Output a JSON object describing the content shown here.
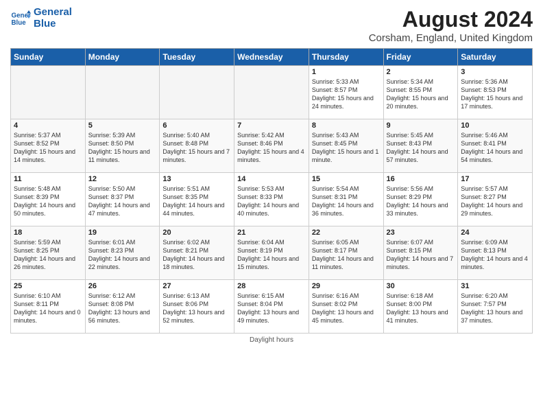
{
  "logo": {
    "line1": "General",
    "line2": "Blue"
  },
  "title": "August 2024",
  "subtitle": "Corsham, England, United Kingdom",
  "days_header": [
    "Sunday",
    "Monday",
    "Tuesday",
    "Wednesday",
    "Thursday",
    "Friday",
    "Saturday"
  ],
  "footer": "Daylight hours",
  "weeks": [
    [
      {
        "num": "",
        "info": ""
      },
      {
        "num": "",
        "info": ""
      },
      {
        "num": "",
        "info": ""
      },
      {
        "num": "",
        "info": ""
      },
      {
        "num": "1",
        "info": "Sunrise: 5:33 AM\nSunset: 8:57 PM\nDaylight: 15 hours\nand 24 minutes."
      },
      {
        "num": "2",
        "info": "Sunrise: 5:34 AM\nSunset: 8:55 PM\nDaylight: 15 hours\nand 20 minutes."
      },
      {
        "num": "3",
        "info": "Sunrise: 5:36 AM\nSunset: 8:53 PM\nDaylight: 15 hours\nand 17 minutes."
      }
    ],
    [
      {
        "num": "4",
        "info": "Sunrise: 5:37 AM\nSunset: 8:52 PM\nDaylight: 15 hours\nand 14 minutes."
      },
      {
        "num": "5",
        "info": "Sunrise: 5:39 AM\nSunset: 8:50 PM\nDaylight: 15 hours\nand 11 minutes."
      },
      {
        "num": "6",
        "info": "Sunrise: 5:40 AM\nSunset: 8:48 PM\nDaylight: 15 hours\nand 7 minutes."
      },
      {
        "num": "7",
        "info": "Sunrise: 5:42 AM\nSunset: 8:46 PM\nDaylight: 15 hours\nand 4 minutes."
      },
      {
        "num": "8",
        "info": "Sunrise: 5:43 AM\nSunset: 8:45 PM\nDaylight: 15 hours\nand 1 minute."
      },
      {
        "num": "9",
        "info": "Sunrise: 5:45 AM\nSunset: 8:43 PM\nDaylight: 14 hours\nand 57 minutes."
      },
      {
        "num": "10",
        "info": "Sunrise: 5:46 AM\nSunset: 8:41 PM\nDaylight: 14 hours\nand 54 minutes."
      }
    ],
    [
      {
        "num": "11",
        "info": "Sunrise: 5:48 AM\nSunset: 8:39 PM\nDaylight: 14 hours\nand 50 minutes."
      },
      {
        "num": "12",
        "info": "Sunrise: 5:50 AM\nSunset: 8:37 PM\nDaylight: 14 hours\nand 47 minutes."
      },
      {
        "num": "13",
        "info": "Sunrise: 5:51 AM\nSunset: 8:35 PM\nDaylight: 14 hours\nand 44 minutes."
      },
      {
        "num": "14",
        "info": "Sunrise: 5:53 AM\nSunset: 8:33 PM\nDaylight: 14 hours\nand 40 minutes."
      },
      {
        "num": "15",
        "info": "Sunrise: 5:54 AM\nSunset: 8:31 PM\nDaylight: 14 hours\nand 36 minutes."
      },
      {
        "num": "16",
        "info": "Sunrise: 5:56 AM\nSunset: 8:29 PM\nDaylight: 14 hours\nand 33 minutes."
      },
      {
        "num": "17",
        "info": "Sunrise: 5:57 AM\nSunset: 8:27 PM\nDaylight: 14 hours\nand 29 minutes."
      }
    ],
    [
      {
        "num": "18",
        "info": "Sunrise: 5:59 AM\nSunset: 8:25 PM\nDaylight: 14 hours\nand 26 minutes."
      },
      {
        "num": "19",
        "info": "Sunrise: 6:01 AM\nSunset: 8:23 PM\nDaylight: 14 hours\nand 22 minutes."
      },
      {
        "num": "20",
        "info": "Sunrise: 6:02 AM\nSunset: 8:21 PM\nDaylight: 14 hours\nand 18 minutes."
      },
      {
        "num": "21",
        "info": "Sunrise: 6:04 AM\nSunset: 8:19 PM\nDaylight: 14 hours\nand 15 minutes."
      },
      {
        "num": "22",
        "info": "Sunrise: 6:05 AM\nSunset: 8:17 PM\nDaylight: 14 hours\nand 11 minutes."
      },
      {
        "num": "23",
        "info": "Sunrise: 6:07 AM\nSunset: 8:15 PM\nDaylight: 14 hours\nand 7 minutes."
      },
      {
        "num": "24",
        "info": "Sunrise: 6:09 AM\nSunset: 8:13 PM\nDaylight: 14 hours\nand 4 minutes."
      }
    ],
    [
      {
        "num": "25",
        "info": "Sunrise: 6:10 AM\nSunset: 8:11 PM\nDaylight: 14 hours\nand 0 minutes."
      },
      {
        "num": "26",
        "info": "Sunrise: 6:12 AM\nSunset: 8:08 PM\nDaylight: 13 hours\nand 56 minutes."
      },
      {
        "num": "27",
        "info": "Sunrise: 6:13 AM\nSunset: 8:06 PM\nDaylight: 13 hours\nand 52 minutes."
      },
      {
        "num": "28",
        "info": "Sunrise: 6:15 AM\nSunset: 8:04 PM\nDaylight: 13 hours\nand 49 minutes."
      },
      {
        "num": "29",
        "info": "Sunrise: 6:16 AM\nSunset: 8:02 PM\nDaylight: 13 hours\nand 45 minutes."
      },
      {
        "num": "30",
        "info": "Sunrise: 6:18 AM\nSunset: 8:00 PM\nDaylight: 13 hours\nand 41 minutes."
      },
      {
        "num": "31",
        "info": "Sunrise: 6:20 AM\nSunset: 7:57 PM\nDaylight: 13 hours\nand 37 minutes."
      }
    ]
  ]
}
